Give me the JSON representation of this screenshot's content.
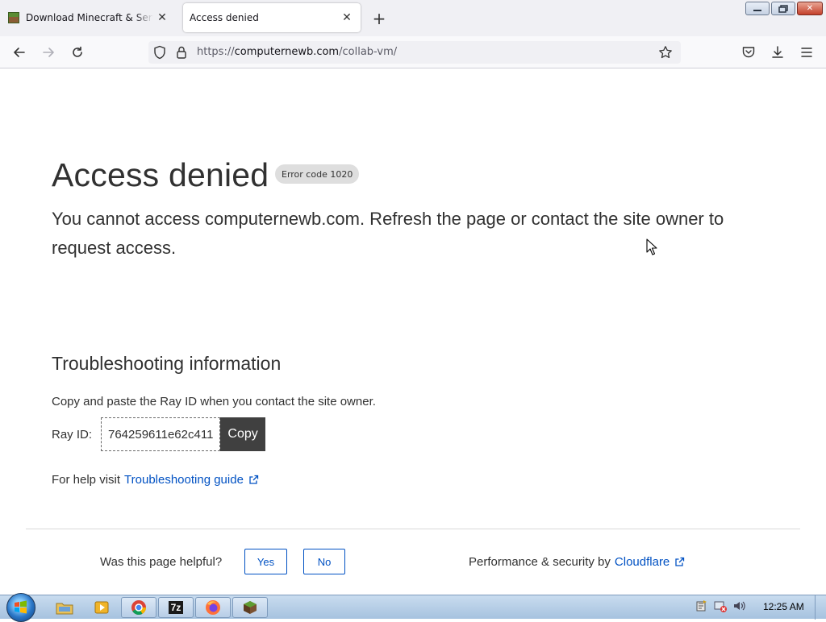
{
  "browser": {
    "tabs": [
      {
        "title": "Download Minecraft & Server Software",
        "active": false
      },
      {
        "title": "Access denied",
        "active": true
      }
    ],
    "url": {
      "scheme": "https://",
      "host": "computernewb.com",
      "path": "/collab-vm/"
    }
  },
  "page": {
    "title": "Access denied",
    "error_code": "Error code 1020",
    "subtitle": "You cannot access computernewb.com. Refresh the page or contact the site owner to request access.",
    "troubleshooting": {
      "heading": "Troubleshooting information",
      "description": "Copy and paste the Ray ID when you contact the site owner.",
      "ray_label": "Ray ID:",
      "ray_id": "764259611e62c411",
      "copy_label": "Copy",
      "help_prefix": "For help visit",
      "help_link": "Troubleshooting guide"
    },
    "footer": {
      "helpful_question": "Was this page helpful?",
      "yes_label": "Yes",
      "no_label": "No",
      "performance_prefix": "Performance & security by",
      "cloudflare_link": "Cloudflare"
    }
  },
  "taskbar": {
    "clock": "12:25 AM",
    "pinned": [
      "explorer-icon",
      "media-player-icon",
      "chrome-icon",
      "7zip-icon",
      "firefox-icon",
      "minecraft-icon"
    ],
    "seven_zip_label": "7z"
  },
  "colors": {
    "link": "#0051c3",
    "text": "#313131",
    "badge_bg": "#dedede",
    "copy_btn_bg": "#404040"
  }
}
